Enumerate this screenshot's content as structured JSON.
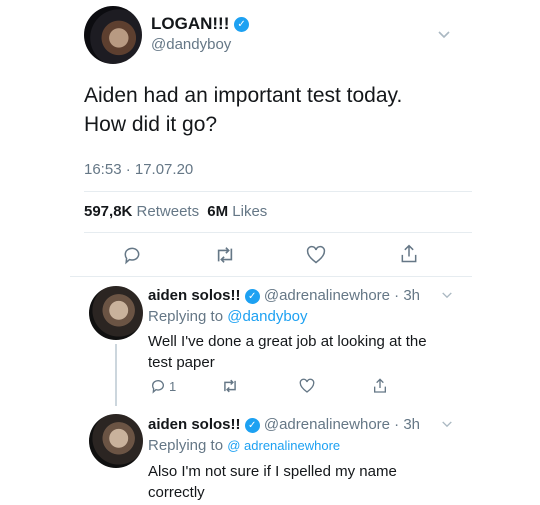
{
  "main_tweet": {
    "display_name": "LOGAN!!!",
    "handle": "@dandyboy",
    "text_line1": "Aiden had an important test today.",
    "text_line2": "How did it go?",
    "timestamp": "16:53 · 17.07.20",
    "retweets_count": "597,8K",
    "retweets_label": "Retweets",
    "likes_count": "6M",
    "likes_label": "Likes"
  },
  "replies": [
    {
      "display_name": "aiden solos!!",
      "handle": "@adrenalinewhore",
      "time": "· 3h",
      "replying_prefix": "Replying to",
      "replying_to": "@dandyboy",
      "text_line1": "Well I've done a great job at looking at the",
      "text_line2": "test paper",
      "reply_count": "1"
    },
    {
      "display_name": "aiden solos!!",
      "handle": "@adrenalinewhore",
      "time": "· 3h",
      "replying_prefix": "Replying to",
      "replying_to": "@ adrenalinewhore",
      "text_line1": "Also I'm not sure if I spelled my name",
      "text_line2": "correctly"
    }
  ],
  "icons": [
    "verified-badge-icon",
    "chevron-down-icon",
    "reply-icon",
    "retweet-icon",
    "like-icon",
    "share-icon"
  ],
  "colors": {
    "accent": "#1da1f2",
    "muted": "#657786",
    "divider": "#e6ecf0",
    "text": "#14171a"
  }
}
